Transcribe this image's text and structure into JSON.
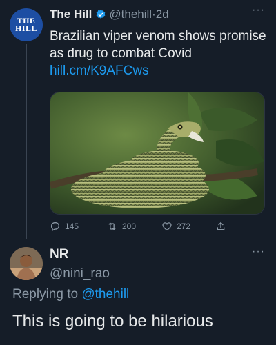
{
  "tweet": {
    "avatar_text_line1": "THE",
    "avatar_text_line2": "HILL",
    "author_name": "The Hill",
    "author_handle": "@thehill",
    "separator": "·",
    "time": "2d",
    "more": "···",
    "text": "Brazilian viper venom shows promise as drug to combat Covid ",
    "link": "hill.cm/K9AFCws",
    "stats": {
      "replies": "145",
      "retweets": "200",
      "likes": "272"
    }
  },
  "reply": {
    "author_name": "NR",
    "author_handle": "@nini_rao",
    "more": "···",
    "replying_prefix": "Replying to ",
    "replying_handle": "@thehill",
    "text": "This is going to be hilarious"
  },
  "colors": {
    "background": "#151d28",
    "link": "#1d9bf0",
    "muted": "#8b98a5",
    "verified": "#1d9bf0"
  },
  "icons": [
    "verified-badge-icon",
    "reply-icon",
    "retweet-icon",
    "like-icon",
    "share-icon"
  ]
}
